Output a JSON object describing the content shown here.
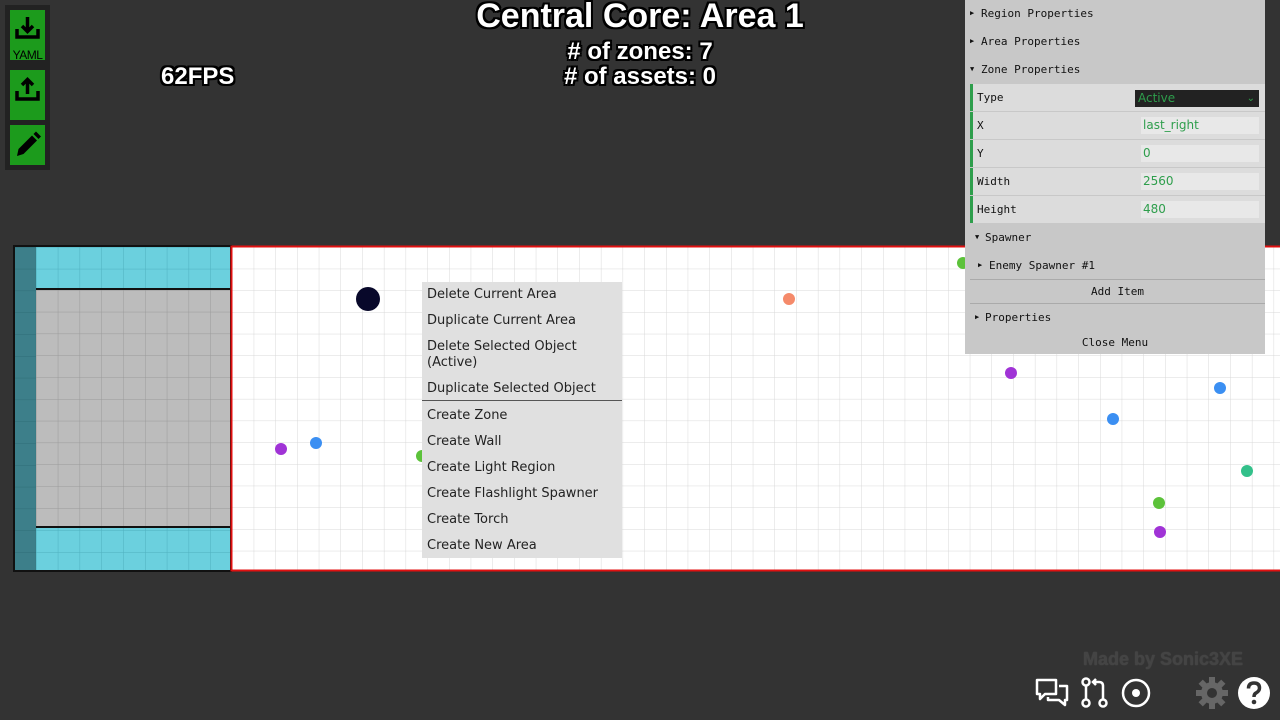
{
  "title": "Central Core: Area 1",
  "zones_text": "# of zones: 7",
  "assets_text": "# of assets: 0",
  "fps_text": "62FPS",
  "toolbar": {
    "yaml_label": "YAML",
    "download_icon": "download-icon",
    "upload_icon": "upload-icon",
    "edit_icon": "pencil-icon"
  },
  "context_menu": {
    "items": [
      "Delete Current Area",
      "Duplicate Current Area",
      "Delete Selected Object",
      "(Active)",
      "Duplicate Selected Object",
      "Create Zone",
      "Create Wall",
      "Create Light Region",
      "Create Flashlight Spawner",
      "Create Torch",
      "Create New Area"
    ]
  },
  "panel": {
    "region_properties": "Region Properties",
    "area_properties": "Area Properties",
    "zone_properties": "Zone Properties",
    "type_label": "Type",
    "type_value": "Active",
    "x_label": "X",
    "x_value": "last_right",
    "y_label": "Y",
    "y_value": "0",
    "width_label": "Width",
    "width_value": "2560",
    "height_label": "Height",
    "height_value": "480",
    "spawner": "Spawner",
    "enemy_spawner": "Enemy Spawner #1",
    "add_item": "Add Item",
    "properties": "Properties",
    "close_menu": "Close Menu"
  },
  "credit": "Made by Sonic3XE",
  "bottom_icons": [
    "chat-icon",
    "pull-request-icon",
    "target-icon",
    "gear-icon",
    "help-icon"
  ],
  "colors": {
    "background": "#333333",
    "green": "#1c9b1c",
    "active_text": "#2e9e4c",
    "zone_border": "#e01010",
    "safe_zone": "#6bd0de",
    "wall": "#bcbcbc"
  }
}
